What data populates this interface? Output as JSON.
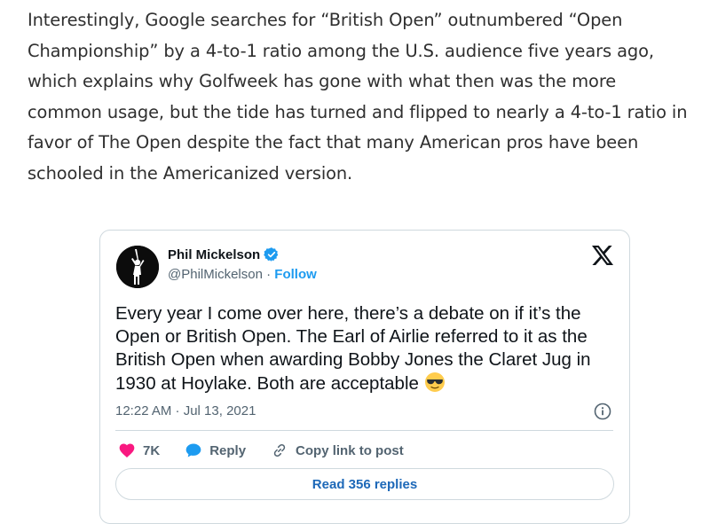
{
  "article": {
    "paragraph": "Interestingly, Google searches for “British Open” outnumbered “Open Championship” by a 4-to-1 ratio among the U.S. audience five years ago, which explains why Golfweek has gone with what then was the more common usage, but the tide has turned and flipped to nearly a 4-to-1 ratio in favor of The Open despite the fact that many American pros have been schooled in the Americanized version."
  },
  "tweet": {
    "author_name": "Phil Mickelson",
    "handle": "@PhilMickelson",
    "separator": "·",
    "follow_label": "Follow",
    "text": "Every year I come over here, there’s a debate on if it’s the Open or British Open. The Earl of Airlie referred to it as the British Open when awarding Bobby Jones the Claret Jug in 1930 at Hoylake. Both are acceptable",
    "emoji_icon": "sunglasses-emoji-icon",
    "timestamp": "12:22 AM · Jul 13, 2021",
    "like_count": "7K",
    "reply_label": "Reply",
    "copy_link_label": "Copy link to post",
    "read_replies_label": "Read 356 replies",
    "colors": {
      "like": "#f91880",
      "reply": "#1d9bf0",
      "link": "#1d9bf0",
      "border": "#cfd9de"
    }
  }
}
